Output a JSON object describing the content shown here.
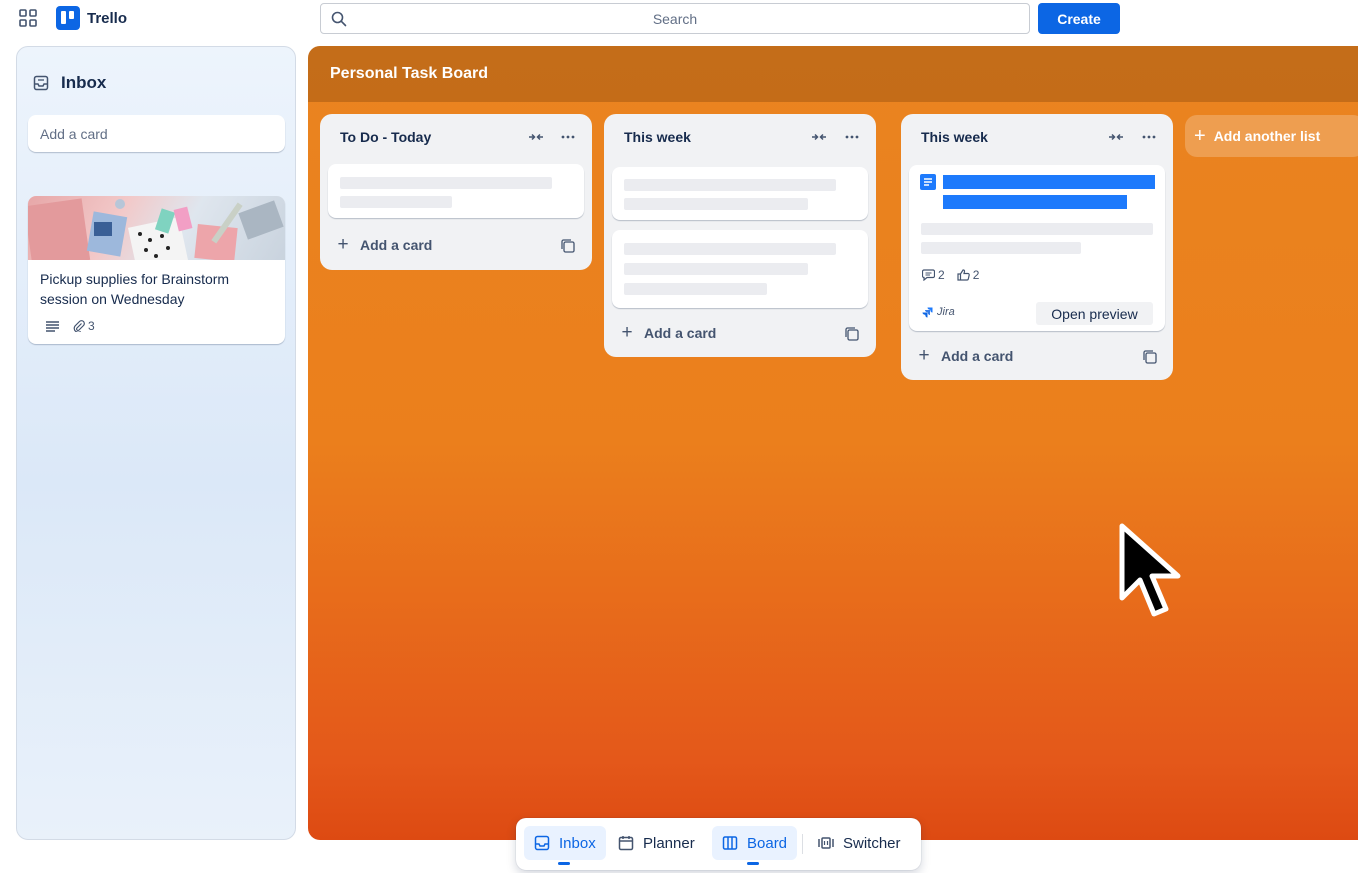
{
  "app": {
    "name": "Trello"
  },
  "search": {
    "placeholder": "Search"
  },
  "toolbar": {
    "create_label": "Create"
  },
  "inbox": {
    "title": "Inbox",
    "add_placeholder": "Add a card",
    "card": {
      "title": "Pickup supplies for Brainstorm session on Wednesday",
      "attachments": "3"
    }
  },
  "board": {
    "title": "Personal Task Board",
    "add_list_label": "Add another list",
    "lists": [
      {
        "title": "To Do - Today",
        "add_card_label": "Add a card"
      },
      {
        "title": "This week",
        "add_card_label": "Add a card"
      },
      {
        "title": "This week",
        "add_card_label": "Add a card",
        "card": {
          "comments": "2",
          "likes": "2",
          "source": "Jira",
          "preview_label": "Open preview"
        }
      }
    ]
  },
  "switcher": {
    "items": [
      {
        "label": "Inbox",
        "active": true
      },
      {
        "label": "Planner",
        "active": false
      },
      {
        "label": "Board",
        "active": true
      },
      {
        "label": "Switcher",
        "active": false
      }
    ]
  },
  "colors": {
    "accent": "#0c66e4",
    "board_top": "#ea8420",
    "board_bottom": "#dd4a12",
    "list_bg": "#f1f2f4"
  }
}
